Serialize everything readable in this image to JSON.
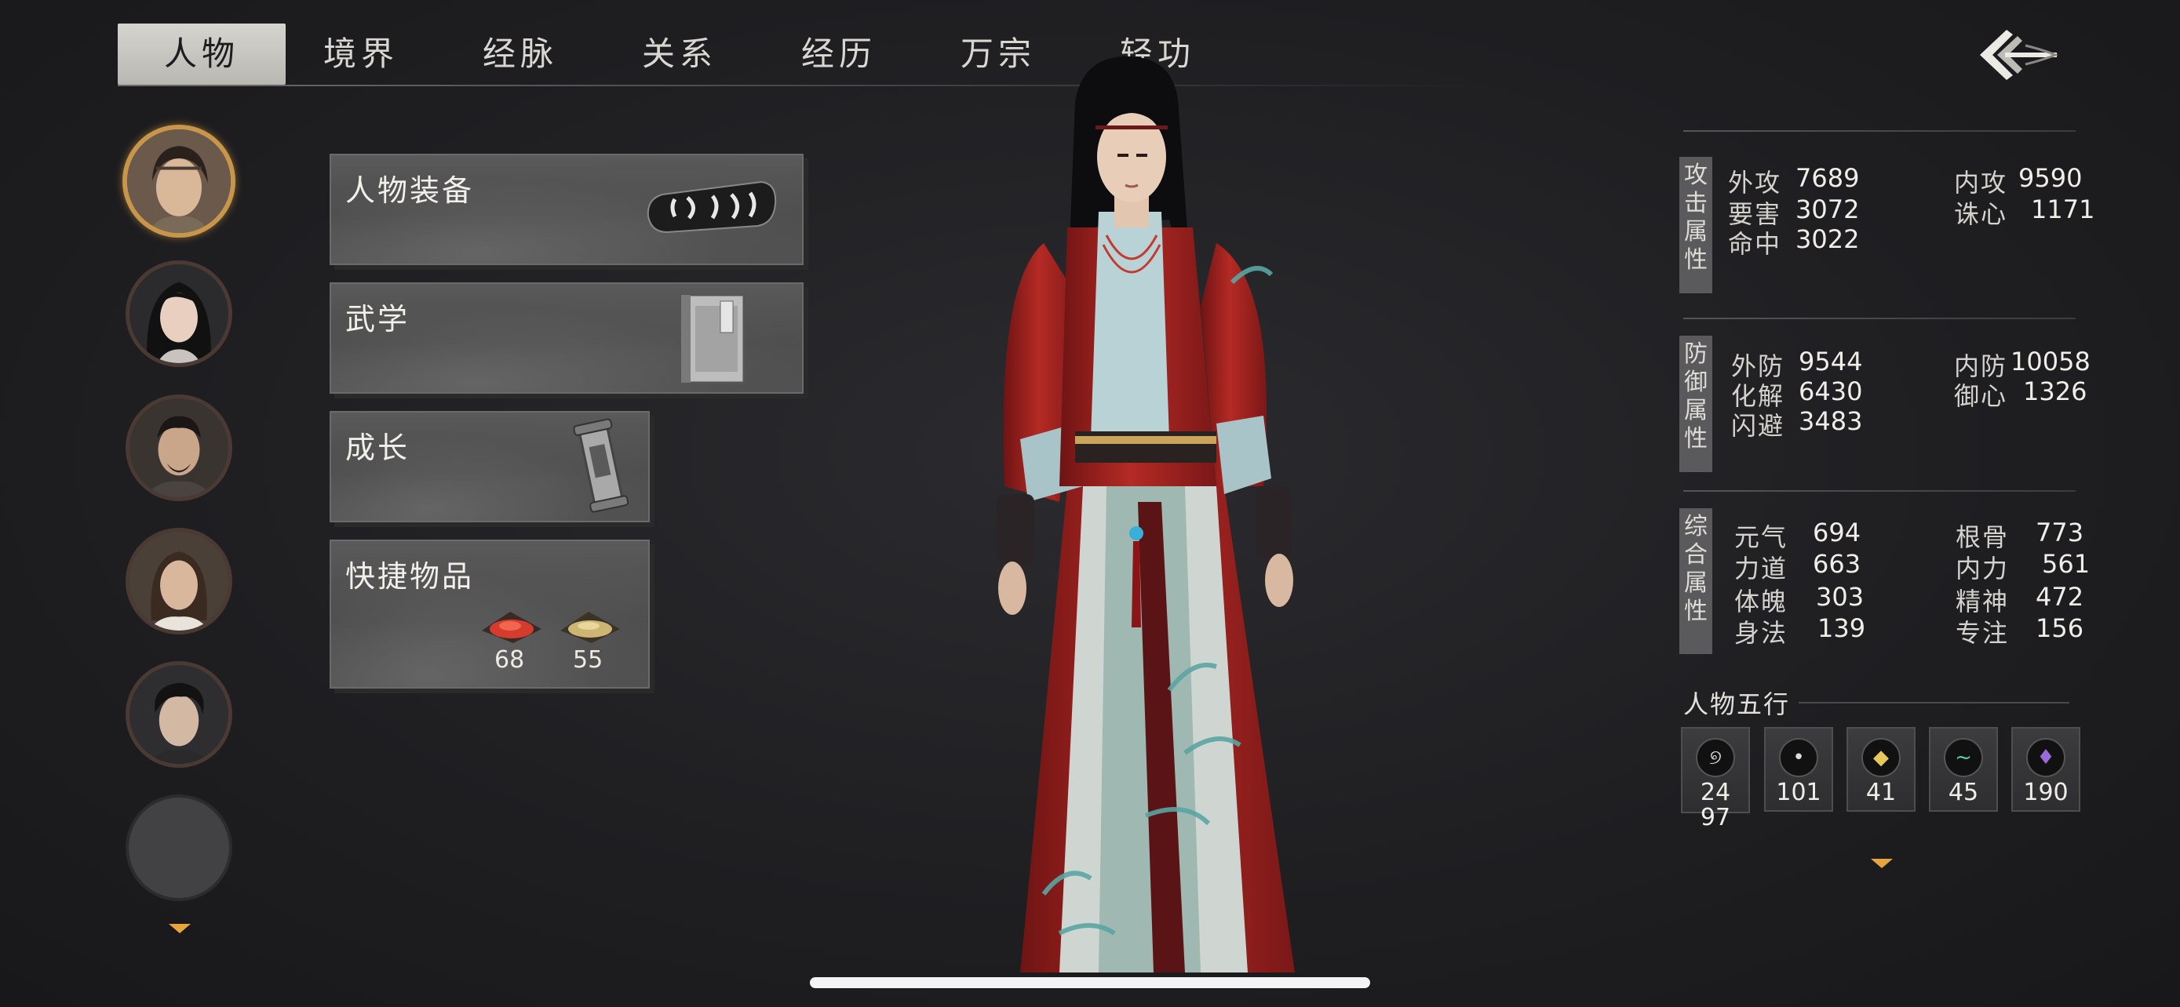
{
  "tabs": [
    {
      "label": "人物",
      "active": true
    },
    {
      "label": "境界",
      "active": false
    },
    {
      "label": "经脉",
      "active": false
    },
    {
      "label": "关系",
      "active": false
    },
    {
      "label": "经历",
      "active": false
    },
    {
      "label": "万宗",
      "active": false
    },
    {
      "label": "轻功",
      "active": false
    }
  ],
  "roster": {
    "avatars": [
      "avatar-selected-young-man",
      "avatar-woman",
      "avatar-bearded-man",
      "avatar-long-hair-man",
      "avatar-dark-hair-man",
      "avatar-empty"
    ],
    "more_icon": "chevron-down-icon"
  },
  "panels": {
    "equipment": {
      "title": "人物装备",
      "icon": "bracer-icon"
    },
    "martial_arts": {
      "title": "武学",
      "icon": "book-icon"
    },
    "growth": {
      "title": "成长",
      "icon": "scroll-icon"
    },
    "quick_items": {
      "title": "快捷物品",
      "items": [
        {
          "icon": "red-powder-icon",
          "count": "68"
        },
        {
          "icon": "yellow-powder-icon",
          "count": "55"
        }
      ]
    }
  },
  "stats": {
    "attack": {
      "label": "攻击属性",
      "rows": [
        {
          "name": "外攻",
          "value": "7689"
        },
        {
          "name": "要害",
          "value": "3072"
        },
        {
          "name": "命中",
          "value": "3022"
        }
      ],
      "right_rows": [
        {
          "name": "内攻",
          "value": "9590"
        },
        {
          "name": "诛心",
          "value": "1171"
        }
      ]
    },
    "defense": {
      "label": "防御属性",
      "rows": [
        {
          "name": "外防",
          "value": "9544"
        },
        {
          "name": "化解",
          "value": "6430"
        },
        {
          "name": "闪避",
          "value": "3483"
        }
      ],
      "right_rows": [
        {
          "name": "内防",
          "value": "10058"
        },
        {
          "name": "御心",
          "value": "1326"
        }
      ]
    },
    "general": {
      "label": "综合属性",
      "rows": [
        {
          "name": "元气",
          "value": "694"
        },
        {
          "name": "力道",
          "value": "663"
        },
        {
          "name": "体魄",
          "value": "303"
        },
        {
          "name": "身法",
          "value": "139"
        }
      ],
      "right_rows": [
        {
          "name": "根骨",
          "value": "773"
        },
        {
          "name": "内力",
          "value": "561"
        },
        {
          "name": "精神",
          "value": "472"
        },
        {
          "name": "专注",
          "value": "156"
        }
      ]
    }
  },
  "wuxing": {
    "title": "人物五行",
    "elements": [
      {
        "icon": "swirl-icon",
        "glyph": "୭",
        "value": "2497"
      },
      {
        "icon": "water-drop-icon",
        "glyph": "•",
        "value": "101"
      },
      {
        "icon": "gold-nugget-icon",
        "glyph": "◆",
        "value": "41"
      },
      {
        "icon": "wind-icon",
        "glyph": "~",
        "value": "45"
      },
      {
        "icon": "flame-icon",
        "glyph": "♦",
        "value": "190"
      }
    ],
    "expand_icon": "chevron-down-icon"
  },
  "colors": {
    "accent": "#e7a63c",
    "panel": "#505051",
    "background": "#1f1f22"
  }
}
